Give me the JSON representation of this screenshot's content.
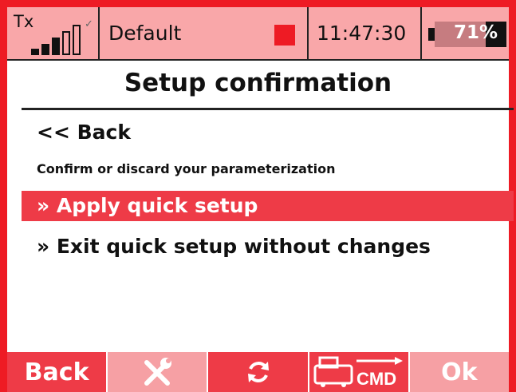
{
  "status_bar": {
    "tx_label": "Tx",
    "signal_bars": [
      true,
      true,
      true,
      false,
      false
    ],
    "model_name": "Default",
    "record_color": "#ee1b24",
    "time": "11:47:30",
    "battery": {
      "level": 0.71,
      "label": "71%"
    }
  },
  "page": {
    "title": "Setup confirmation",
    "back_label": "<< Back",
    "subtitle": "Confirm or discard your parameterization",
    "options": [
      {
        "label": "» Apply quick setup",
        "selected": true
      },
      {
        "label": "» Exit quick setup without changes",
        "selected": false
      }
    ]
  },
  "footer": {
    "back_label": "Back",
    "tools_icon": "wrench-screwdriver-icon",
    "refresh_icon": "refresh-icon",
    "cmd_label": "CMD",
    "cmd_icon": "transmitter-cmd-icon",
    "ok_label": "Ok"
  },
  "colors": {
    "accent": "#ee1b24",
    "selection": "#ee3b47",
    "header_bg": "#f9a7a9"
  }
}
